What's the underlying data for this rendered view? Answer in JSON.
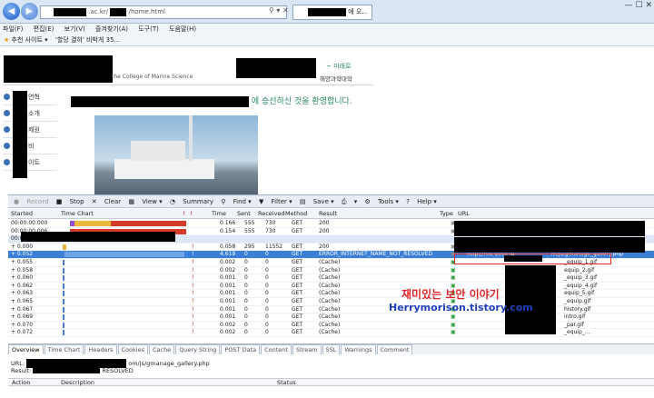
{
  "browser": {
    "address_domain": ".ac.kr/",
    "address_path": "/home.html",
    "tab_suffix": "에 오...",
    "nav_back": "◀",
    "nav_forward": "▶",
    "window_controls": "— ☐ ✕"
  },
  "menu": [
    "파일(F)",
    "편집(E)",
    "보기(V)",
    "즐겨찾기(A)",
    "도구(T)",
    "도움말(H)"
  ],
  "favorites": {
    "item1": "추천 사이트 ▾",
    "item2": "'할당 결혀' 비박게 35..."
  },
  "page": {
    "slogan": "~ 미래로",
    "college_en": "the College of Marine Science",
    "college_kr": "해양과학대학",
    "welcome": "에 승선하신 것을 환영합니다.",
    "nav_items": [
      "연혁",
      "소개",
      "제원",
      "비",
      "이트"
    ]
  },
  "fiddler": {
    "toolbar": [
      "Record",
      "Stop",
      "Clear",
      "View ▾",
      "Summary",
      "Find ▾",
      "Filter ▾",
      "Save ▾",
      "▾",
      "Tools ▾",
      "Help ▾"
    ],
    "columns": [
      "Started",
      "Time Chart",
      "!",
      "!",
      "Time",
      "Sent",
      "Received",
      "Method",
      "Result",
      "Type",
      "URL"
    ],
    "rows": [
      {
        "started": "00:00:00.000",
        "time": "0.166",
        "sent": "555",
        "recv": "730",
        "method": "GET",
        "result": "200",
        "url": ""
      },
      {
        "started": "00:00:00.006",
        "time": "0.154",
        "sent": "555",
        "recv": "730",
        "method": "GET",
        "result": "200",
        "url": ""
      },
      {
        "started": "00:00:00.893",
        "time": "",
        "sent": "",
        "recv": "",
        "method": "",
        "result": "",
        "url": ""
      },
      {
        "started": "+ 0.000",
        "time": "0.058",
        "sent": "295",
        "recv": "11552",
        "method": "GET",
        "result": "200",
        "url": ""
      },
      {
        "started": "+ 0.052",
        "time": "4.619",
        "sent": "0",
        "recv": "0",
        "method": "GET",
        "result": "ERROR_INTERNET_NAME_NOT_RESOLVED",
        "url": "http://red-devil-ip",
        "url2": "m/js/gmanage_gallery.php"
      },
      {
        "started": "+ 0.055",
        "time": "0.002",
        "sent": "0",
        "recv": "0",
        "method": "GET",
        "result": "(Cache)",
        "url": "_equip_1.gif"
      },
      {
        "started": "+ 0.058",
        "time": "0.002",
        "sent": "0",
        "recv": "0",
        "method": "GET",
        "result": "(Cache)",
        "url": "equip_2.gif"
      },
      {
        "started": "+ 0.060",
        "time": "0.001",
        "sent": "0",
        "recv": "0",
        "method": "GET",
        "result": "(Cache)",
        "url": "_equip_3.gif"
      },
      {
        "started": "+ 0.062",
        "time": "0.001",
        "sent": "0",
        "recv": "0",
        "method": "GET",
        "result": "(Cache)",
        "url": "_equip_4.gif"
      },
      {
        "started": "+ 0.063",
        "time": "0.001",
        "sent": "0",
        "recv": "0",
        "method": "GET",
        "result": "(Cache)",
        "url": "equip_5.gif"
      },
      {
        "started": "+ 0.065",
        "time": "0.001",
        "sent": "0",
        "recv": "0",
        "method": "GET",
        "result": "(Cache)",
        "url": "_equip.gif"
      },
      {
        "started": "+ 0.067",
        "time": "0.001",
        "sent": "0",
        "recv": "0",
        "method": "GET",
        "result": "(Cache)",
        "url": "history.gif"
      },
      {
        "started": "+ 0.069",
        "time": "0.001",
        "sent": "0",
        "recv": "0",
        "method": "GET",
        "result": "(Cache)",
        "url": "intro.gif"
      },
      {
        "started": "+ 0.070",
        "time": "0.002",
        "sent": "0",
        "recv": "0",
        "method": "GET",
        "result": "(Cache)",
        "url": "_par.gif"
      },
      {
        "started": "+ 0.072",
        "time": "0.002",
        "sent": "0",
        "recv": "0",
        "method": "GET",
        "result": "(Cache)",
        "url": "_equip_..."
      }
    ],
    "detail_tabs": [
      "Overview",
      "Time Chart",
      "Headers",
      "Cookies",
      "Cache",
      "Query String",
      "POST Data",
      "Content",
      "Stream",
      "SSL",
      "Warnings",
      "Comment"
    ],
    "detail": {
      "url_label": "URL:",
      "url_value": "om/js/gmanage_gallery.php",
      "result_label": "Result:",
      "result_value": "RESOLVED",
      "col_action": "Action",
      "col_description": "Description",
      "col_status": "Status"
    }
  },
  "watermark": {
    "line1": "재미있는 보안 이야기",
    "line2": "Herrymorison.tistory.com"
  },
  "colors": {
    "selected_row": "#3b7fd6",
    "error_box": "#e0262b",
    "watermark_red": "#e0262b",
    "watermark_blue": "#1f3fb8"
  }
}
